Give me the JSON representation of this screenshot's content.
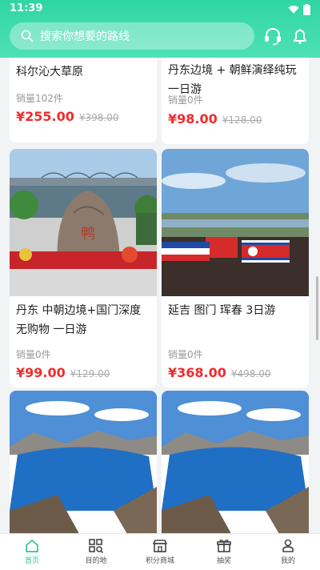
{
  "status": {
    "time": "11:39"
  },
  "search": {
    "placeholder": "搜索你想要的路线"
  },
  "products": [
    {
      "title": "科尔沁大草原",
      "sales": "销量102件",
      "price": "¥255.00",
      "orig": "¥398.00"
    },
    {
      "title": "丹东边境 + 朝鲜演绎纯玩一日游",
      "sales": "销量0件",
      "price": "¥98.00",
      "orig": "¥128.00"
    },
    {
      "title": "丹东 中朝边境+国门深度无购物 一日游",
      "sales": "销量0件",
      "price": "¥99.00",
      "orig": "¥129.00",
      "image_icon": "border-stone-photo"
    },
    {
      "title": "延吉 图门 珲春 3日游",
      "sales": "销量0件",
      "price": "¥368.00",
      "orig": "¥498.00",
      "image_icon": "border-river-flags-photo"
    },
    {
      "image_icon": "mountain-lake-photo"
    },
    {
      "image_icon": "mountain-lake-photo"
    }
  ],
  "tabs": [
    {
      "label": "首页",
      "icon": "home-icon",
      "active": true
    },
    {
      "label": "目的地",
      "icon": "grid-search-icon",
      "active": false
    },
    {
      "label": "积分商城",
      "icon": "store-icon",
      "active": false
    },
    {
      "label": "抽奖",
      "icon": "gift-icon",
      "active": false
    },
    {
      "label": "我的",
      "icon": "user-icon",
      "active": false
    }
  ],
  "colors": {
    "brand": "#30d6a4",
    "price": "#f22b2b",
    "tab_active": "#32c98f"
  }
}
